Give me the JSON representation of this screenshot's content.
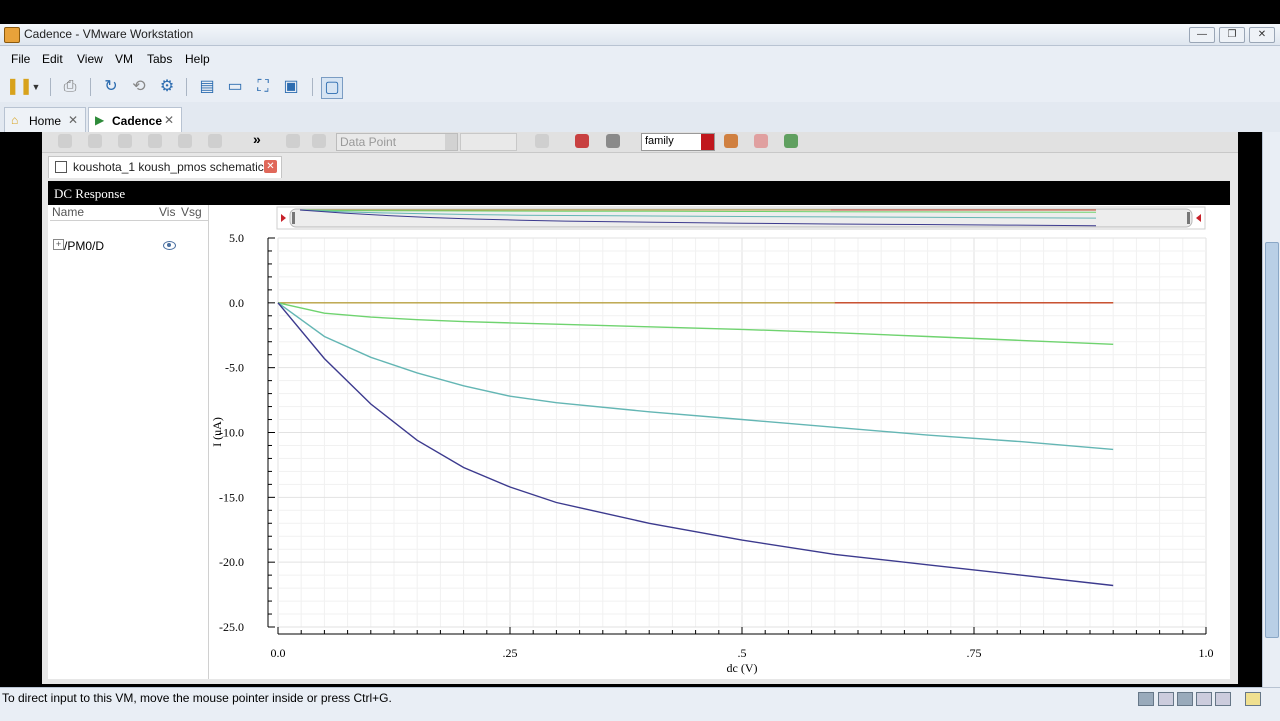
{
  "window": {
    "title": "Cadence - VMware Workstation",
    "btn_min": "—",
    "btn_restore": "❐",
    "btn_close": "✕"
  },
  "menu": [
    "File",
    "Edit",
    "View",
    "VM",
    "Tabs",
    "Help"
  ],
  "vm_tabs": [
    {
      "label": "Home",
      "active": false
    },
    {
      "label": "Cadence",
      "active": true
    }
  ],
  "virtuoso": {
    "data_point_select": "Data Point",
    "family_select": "family",
    "more_glyph": "»",
    "doc_tab": "koushota_1 koush_pmos schematic",
    "plot_title": "DC Response",
    "legend": {
      "headers": {
        "name": "Name",
        "vis": "Vis",
        "vsg": "Vsg"
      },
      "rows": [
        {
          "name": "/PM0/D",
          "visible": true
        }
      ]
    }
  },
  "chart_data": {
    "type": "line",
    "xlabel": "dc (V)",
    "ylabel": "I (uA)",
    "xlim": [
      0.0,
      1.0
    ],
    "ylim": [
      -25.0,
      5.0
    ],
    "x_ticks": [
      "0.0",
      ".25",
      ".5",
      ".75",
      "1.0"
    ],
    "y_ticks": [
      "5.0",
      "0.0",
      "-5.0",
      "-10.0",
      "-15.0",
      "-20.0",
      "-25.0"
    ],
    "grid": true,
    "x": [
      0.0,
      0.05,
      0.1,
      0.15,
      0.2,
      0.25,
      0.3,
      0.4,
      0.5,
      0.6,
      0.7,
      0.8,
      0.9
    ],
    "series": [
      {
        "color": "#b8a040",
        "values": [
          0,
          0,
          0,
          0,
          0,
          0,
          0,
          0,
          0,
          0,
          0,
          0,
          0
        ]
      },
      {
        "color": "#c8462a",
        "x": [
          0.6,
          0.9
        ],
        "values": [
          0,
          0
        ]
      },
      {
        "color": "#6fd36f",
        "values": [
          0,
          -0.8,
          -1.1,
          -1.3,
          -1.45,
          -1.55,
          -1.65,
          -1.85,
          -2.05,
          -2.3,
          -2.6,
          -2.9,
          -3.2
        ]
      },
      {
        "color": "#64b6b4",
        "values": [
          0,
          -2.6,
          -4.2,
          -5.4,
          -6.4,
          -7.2,
          -7.7,
          -8.4,
          -9.0,
          -9.6,
          -10.2,
          -10.7,
          -11.3
        ]
      },
      {
        "color": "#3c3a8e",
        "values": [
          0,
          -4.3,
          -7.8,
          -10.6,
          -12.7,
          -14.2,
          -15.4,
          -17.0,
          -18.3,
          -19.4,
          -20.2,
          -21.0,
          -21.8
        ]
      }
    ]
  },
  "status": {
    "text": "To direct input to this VM, move the mouse pointer inside or press Ctrl+G."
  }
}
